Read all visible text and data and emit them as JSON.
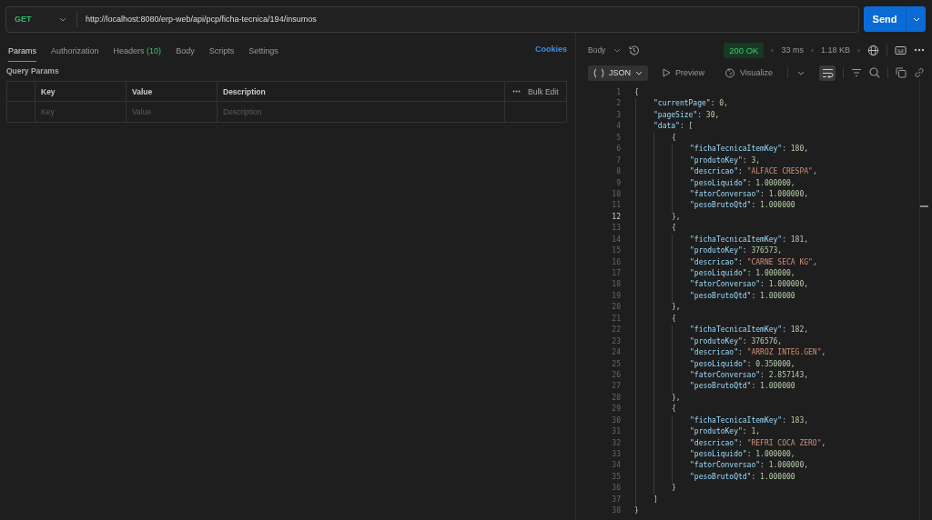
{
  "request": {
    "method": "GET",
    "url": "http://localhost:8080/erp-web/api/pcp/ficha-tecnica/194/insumos",
    "send": "Send"
  },
  "tabs": [
    {
      "label": "Params",
      "selected": true
    },
    {
      "label": "Authorization",
      "selected": false
    },
    {
      "label": "Headers",
      "count": "(10)",
      "selected": false
    },
    {
      "label": "Body",
      "selected": false
    },
    {
      "label": "Scripts",
      "selected": false
    },
    {
      "label": "Settings",
      "selected": false
    }
  ],
  "cookies": "Cookies",
  "query_params": {
    "title": "Query Params",
    "columns": [
      "Key",
      "Value",
      "Description"
    ],
    "bulk_edit": "Bulk Edit",
    "placeholders": [
      "Key",
      "Value",
      "Description"
    ]
  },
  "response": {
    "body_label": "Body",
    "status": "200 OK",
    "time": "33 ms",
    "size": "1.18 KB",
    "views": [
      {
        "label": "JSON",
        "selected": true
      },
      {
        "label": "Preview",
        "selected": false
      },
      {
        "label": "Visualize",
        "selected": false
      }
    ],
    "lines": [
      {
        "number": "1",
        "current": false,
        "tokens": [
          {
            "kind": "open",
            "text": "{"
          }
        ]
      },
      {
        "number": "2",
        "current": false,
        "tokens": [
          {
            "kind": "key",
            "text": "\"currentPage\""
          },
          {
            "kind": "punct",
            "text": ": "
          },
          {
            "kind": "number",
            "text": "0"
          },
          {
            "kind": "punct",
            "text": ","
          }
        ]
      },
      {
        "number": "3",
        "current": false,
        "tokens": [
          {
            "kind": "key",
            "text": "\"pageSize\""
          },
          {
            "kind": "punct",
            "text": ": "
          },
          {
            "kind": "number",
            "text": "30"
          },
          {
            "kind": "punct",
            "text": ","
          }
        ]
      },
      {
        "number": "4",
        "current": false,
        "tokens": [
          {
            "kind": "key",
            "text": "\"data\""
          },
          {
            "kind": "punct",
            "text": ": "
          },
          {
            "kind": "open",
            "text": "["
          }
        ]
      },
      {
        "number": "5",
        "current": false,
        "tokens": [
          {
            "kind": "open",
            "text": "{"
          }
        ]
      },
      {
        "number": "6",
        "current": false,
        "tokens": [
          {
            "kind": "key",
            "text": "\"fichaTecnicaItemKey\""
          },
          {
            "kind": "punct",
            "text": ": "
          },
          {
            "kind": "number",
            "text": "180"
          },
          {
            "kind": "punct",
            "text": ","
          }
        ]
      },
      {
        "number": "7",
        "current": false,
        "tokens": [
          {
            "kind": "key",
            "text": "\"produtoKey\""
          },
          {
            "kind": "punct",
            "text": ": "
          },
          {
            "kind": "number",
            "text": "3"
          },
          {
            "kind": "punct",
            "text": ","
          }
        ]
      },
      {
        "number": "8",
        "current": false,
        "tokens": [
          {
            "kind": "key",
            "text": "\"descricao\""
          },
          {
            "kind": "punct",
            "text": ": "
          },
          {
            "kind": "string",
            "text": "\"ALFACE CRESPA\""
          },
          {
            "kind": "punct",
            "text": ","
          }
        ]
      },
      {
        "number": "9",
        "current": false,
        "tokens": [
          {
            "kind": "key",
            "text": "\"pesoLiquido\""
          },
          {
            "kind": "punct",
            "text": ": "
          },
          {
            "kind": "number",
            "text": "1.000000"
          },
          {
            "kind": "punct",
            "text": ","
          }
        ]
      },
      {
        "number": "10",
        "current": false,
        "tokens": [
          {
            "kind": "key",
            "text": "\"fatorConversao\""
          },
          {
            "kind": "punct",
            "text": ": "
          },
          {
            "kind": "number",
            "text": "1.000000"
          },
          {
            "kind": "punct",
            "text": ","
          }
        ]
      },
      {
        "number": "11",
        "current": false,
        "tokens": [
          {
            "kind": "key",
            "text": "\"pesoBrutoQtd\""
          },
          {
            "kind": "punct",
            "text": ": "
          },
          {
            "kind": "number",
            "text": "1.000000"
          }
        ]
      },
      {
        "number": "12",
        "current": true,
        "tokens": [
          {
            "kind": "close",
            "text": "}"
          },
          {
            "kind": "punct",
            "text": ","
          }
        ]
      },
      {
        "number": "13",
        "current": false,
        "tokens": [
          {
            "kind": "open",
            "text": "{"
          }
        ]
      },
      {
        "number": "14",
        "current": false,
        "tokens": [
          {
            "kind": "key",
            "text": "\"fichaTecnicaItemKey\""
          },
          {
            "kind": "punct",
            "text": ": "
          },
          {
            "kind": "number",
            "text": "181"
          },
          {
            "kind": "punct",
            "text": ","
          }
        ]
      },
      {
        "number": "15",
        "current": false,
        "tokens": [
          {
            "kind": "key",
            "text": "\"produtoKey\""
          },
          {
            "kind": "punct",
            "text": ": "
          },
          {
            "kind": "number",
            "text": "376573"
          },
          {
            "kind": "punct",
            "text": ","
          }
        ]
      },
      {
        "number": "16",
        "current": false,
        "tokens": [
          {
            "kind": "key",
            "text": "\"descricao\""
          },
          {
            "kind": "punct",
            "text": ": "
          },
          {
            "kind": "string",
            "text": "\"CARNE SECA KG\""
          },
          {
            "kind": "punct",
            "text": ","
          }
        ]
      },
      {
        "number": "17",
        "current": false,
        "tokens": [
          {
            "kind": "key",
            "text": "\"pesoLiquido\""
          },
          {
            "kind": "punct",
            "text": ": "
          },
          {
            "kind": "number",
            "text": "1.000000"
          },
          {
            "kind": "punct",
            "text": ","
          }
        ]
      },
      {
        "number": "18",
        "current": false,
        "tokens": [
          {
            "kind": "key",
            "text": "\"fatorConversao\""
          },
          {
            "kind": "punct",
            "text": ": "
          },
          {
            "kind": "number",
            "text": "1.000000"
          },
          {
            "kind": "punct",
            "text": ","
          }
        ]
      },
      {
        "number": "19",
        "current": false,
        "tokens": [
          {
            "kind": "key",
            "text": "\"pesoBrutoQtd\""
          },
          {
            "kind": "punct",
            "text": ": "
          },
          {
            "kind": "number",
            "text": "1.000000"
          }
        ]
      },
      {
        "number": "20",
        "current": false,
        "tokens": [
          {
            "kind": "close",
            "text": "}"
          },
          {
            "kind": "punct",
            "text": ","
          }
        ]
      },
      {
        "number": "21",
        "current": false,
        "tokens": [
          {
            "kind": "open",
            "text": "{"
          }
        ]
      },
      {
        "number": "22",
        "current": false,
        "tokens": [
          {
            "kind": "key",
            "text": "\"fichaTecnicaItemKey\""
          },
          {
            "kind": "punct",
            "text": ": "
          },
          {
            "kind": "number",
            "text": "182"
          },
          {
            "kind": "punct",
            "text": ","
          }
        ]
      },
      {
        "number": "23",
        "current": false,
        "tokens": [
          {
            "kind": "key",
            "text": "\"produtoKey\""
          },
          {
            "kind": "punct",
            "text": ": "
          },
          {
            "kind": "number",
            "text": "376576"
          },
          {
            "kind": "punct",
            "text": ","
          }
        ]
      },
      {
        "number": "24",
        "current": false,
        "tokens": [
          {
            "kind": "key",
            "text": "\"descricao\""
          },
          {
            "kind": "punct",
            "text": ": "
          },
          {
            "kind": "string",
            "text": "\"ARROZ INTEG.GEN\""
          },
          {
            "kind": "punct",
            "text": ","
          }
        ]
      },
      {
        "number": "25",
        "current": false,
        "tokens": [
          {
            "kind": "key",
            "text": "\"pesoLiquido\""
          },
          {
            "kind": "punct",
            "text": ": "
          },
          {
            "kind": "number",
            "text": "0.350000"
          },
          {
            "kind": "punct",
            "text": ","
          }
        ]
      },
      {
        "number": "26",
        "current": false,
        "tokens": [
          {
            "kind": "key",
            "text": "\"fatorConversao\""
          },
          {
            "kind": "punct",
            "text": ": "
          },
          {
            "kind": "number",
            "text": "2.857143"
          },
          {
            "kind": "punct",
            "text": ","
          }
        ]
      },
      {
        "number": "27",
        "current": false,
        "tokens": [
          {
            "kind": "key",
            "text": "\"pesoBrutoQtd\""
          },
          {
            "kind": "punct",
            "text": ": "
          },
          {
            "kind": "number",
            "text": "1.000000"
          }
        ]
      },
      {
        "number": "28",
        "current": false,
        "tokens": [
          {
            "kind": "close",
            "text": "}"
          },
          {
            "kind": "punct",
            "text": ","
          }
        ]
      },
      {
        "number": "29",
        "current": false,
        "tokens": [
          {
            "kind": "open",
            "text": "{"
          }
        ]
      },
      {
        "number": "30",
        "current": false,
        "tokens": [
          {
            "kind": "key",
            "text": "\"fichaTecnicaItemKey\""
          },
          {
            "kind": "punct",
            "text": ": "
          },
          {
            "kind": "number",
            "text": "183"
          },
          {
            "kind": "punct",
            "text": ","
          }
        ]
      },
      {
        "number": "31",
        "current": false,
        "tokens": [
          {
            "kind": "key",
            "text": "\"produtoKey\""
          },
          {
            "kind": "punct",
            "text": ": "
          },
          {
            "kind": "number",
            "text": "1"
          },
          {
            "kind": "punct",
            "text": ","
          }
        ]
      },
      {
        "number": "32",
        "current": false,
        "tokens": [
          {
            "kind": "key",
            "text": "\"descricao\""
          },
          {
            "kind": "punct",
            "text": ": "
          },
          {
            "kind": "string",
            "text": "\"REFRI COCA ZERO\""
          },
          {
            "kind": "punct",
            "text": ","
          }
        ]
      },
      {
        "number": "33",
        "current": false,
        "tokens": [
          {
            "kind": "key",
            "text": "\"pesoLiquido\""
          },
          {
            "kind": "punct",
            "text": ": "
          },
          {
            "kind": "number",
            "text": "1.000000"
          },
          {
            "kind": "punct",
            "text": ","
          }
        ]
      },
      {
        "number": "34",
        "current": false,
        "tokens": [
          {
            "kind": "key",
            "text": "\"fatorConversao\""
          },
          {
            "kind": "punct",
            "text": ": "
          },
          {
            "kind": "number",
            "text": "1.000000"
          },
          {
            "kind": "punct",
            "text": ","
          }
        ]
      },
      {
        "number": "35",
        "current": false,
        "tokens": [
          {
            "kind": "key",
            "text": "\"pesoBrutoQtd\""
          },
          {
            "kind": "punct",
            "text": ": "
          },
          {
            "kind": "number",
            "text": "1.000000"
          }
        ]
      },
      {
        "number": "36",
        "current": false,
        "tokens": [
          {
            "kind": "close",
            "text": "}"
          }
        ]
      },
      {
        "number": "37",
        "current": false,
        "tokens": [
          {
            "kind": "close",
            "text": "]"
          }
        ]
      },
      {
        "number": "38",
        "current": false,
        "tokens": [
          {
            "kind": "close",
            "text": "}"
          }
        ]
      }
    ]
  }
}
